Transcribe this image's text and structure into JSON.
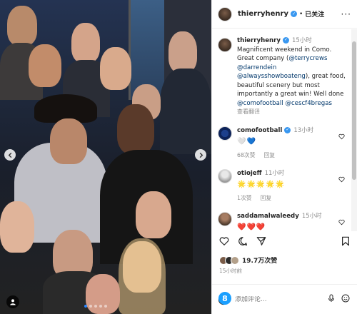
{
  "post": {
    "username": "thierryhenry",
    "follow_status": "已关注",
    "separator": "•",
    "more_label": "···"
  },
  "caption": {
    "username": "thierryhenry",
    "time": "15小时",
    "text_1": "Magnificent weekend in Como. Great company (",
    "mention_1": "@terrycrews",
    "mention_2": "@darrendein",
    "mention_3": "@alwaysshowboateng",
    "text_2": "), great food, beautiful scenery but most importantly a great win! Well done",
    "mention_4": "@comofootball",
    "mention_5": "@cescf4bregas",
    "see_translation": "查看翻译"
  },
  "comments": [
    {
      "username": "comofootball",
      "time": "13小时",
      "emoji": "🤍💙",
      "likes": "68次赞",
      "reply": "回复"
    },
    {
      "username": "otiojeff",
      "time": "11小时",
      "emoji": "🌟🌟🌟🌟🌟",
      "likes": "1次赞",
      "reply": "回复"
    },
    {
      "username": "saddamalwaleedy",
      "time": "15小时",
      "emoji": "❤️❤️❤️",
      "likes": "",
      "reply": ""
    }
  ],
  "likes_count": "19.7万次赞",
  "post_time": "15小时前",
  "comment_placeholder": "添加评论...",
  "logo_label": "8",
  "colors": {
    "accent": "#3897f0",
    "link": "#00376b",
    "muted": "#8e8e8e"
  },
  "carousel": {
    "total": 5,
    "active_index": 0
  }
}
